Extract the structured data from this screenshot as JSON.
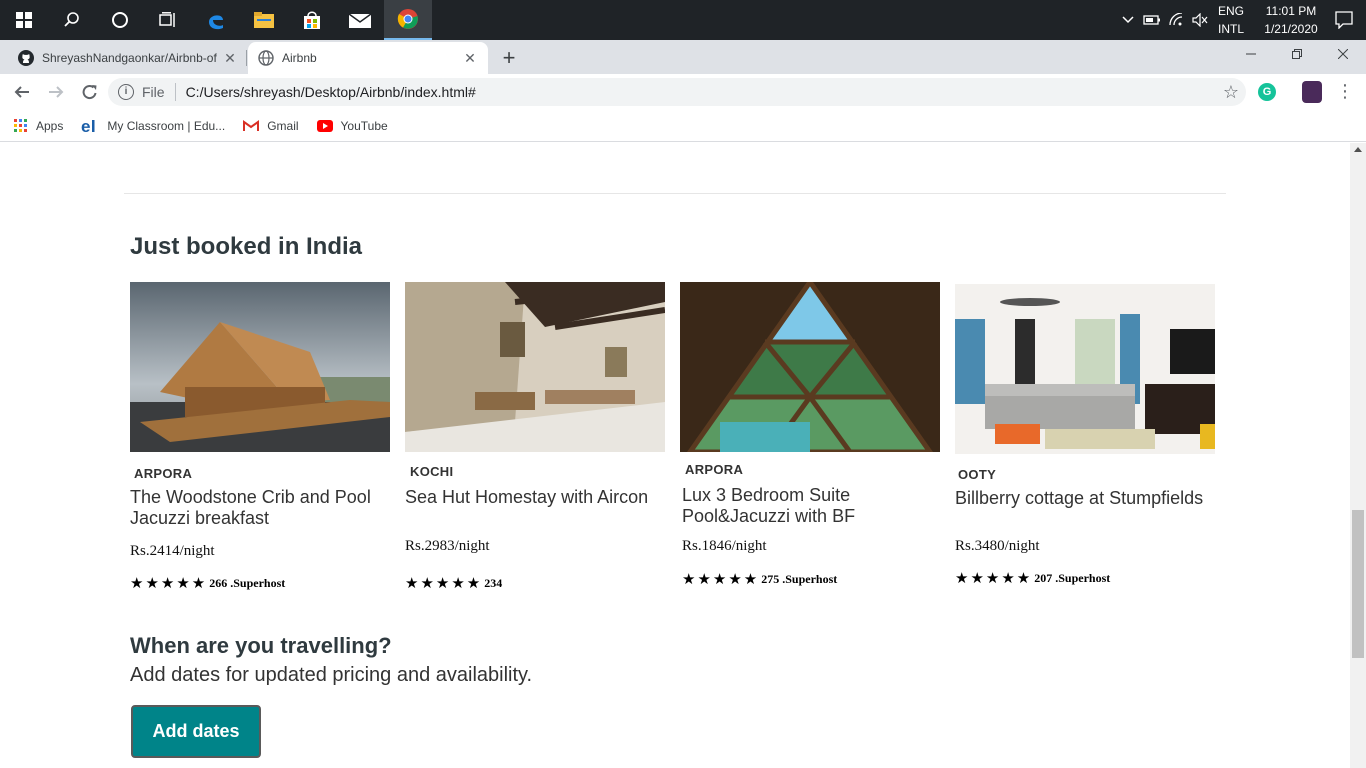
{
  "taskbar": {
    "language": [
      "ENG",
      "INTL"
    ],
    "time": "11:01 PM",
    "date": "1/21/2020"
  },
  "browser": {
    "tabs": [
      {
        "title": "ShreyashNandgaonkar/Airbnb-of",
        "icon": "github-icon",
        "active": false
      },
      {
        "title": "Airbnb",
        "icon": "globe-icon",
        "active": true
      }
    ],
    "omnibox": {
      "scheme_label": "File",
      "url": "C:/Users/shreyash/Desktop/Airbnb/index.html#"
    },
    "bookmarks": [
      {
        "label": "Apps",
        "icon": "apps-grid-icon"
      },
      {
        "label": "My Classroom | Edu...",
        "icon": "edureka-icon"
      },
      {
        "label": "Gmail",
        "icon": "gmail-icon"
      },
      {
        "label": "YouTube",
        "icon": "youtube-icon"
      }
    ]
  },
  "page": {
    "section_title": "Just booked in India",
    "listings": [
      {
        "location": "ARPORA",
        "name": "The Woodstone Crib and Pool Jacuzzi breakfast",
        "price": "Rs.2414/night",
        "stars": 5,
        "rating_text": "266 .Superhost"
      },
      {
        "location": "KOCHI",
        "name": "Sea Hut Homestay with Aircon",
        "price": "Rs.2983/night",
        "stars": 5,
        "rating_text": "234"
      },
      {
        "location": "ARPORA",
        "name": "Lux 3 Bedroom Suite Pool&Jacuzzi with BF",
        "price": "Rs.1846/night",
        "stars": 5,
        "rating_text": "275 .Superhost"
      },
      {
        "location": "OOTY",
        "name": "Billberry cottage at Stumpfields",
        "price": "Rs.3480/night",
        "stars": 5,
        "rating_text": "207 .Superhost"
      }
    ],
    "travel_title": "When are you travelling?",
    "travel_subtitle": "Add dates for updated pricing and availability.",
    "add_dates_label": "Add dates"
  },
  "colors": {
    "accent": "#008489",
    "taskbar": "#1f2327",
    "tabstrip": "#dee1e6"
  }
}
